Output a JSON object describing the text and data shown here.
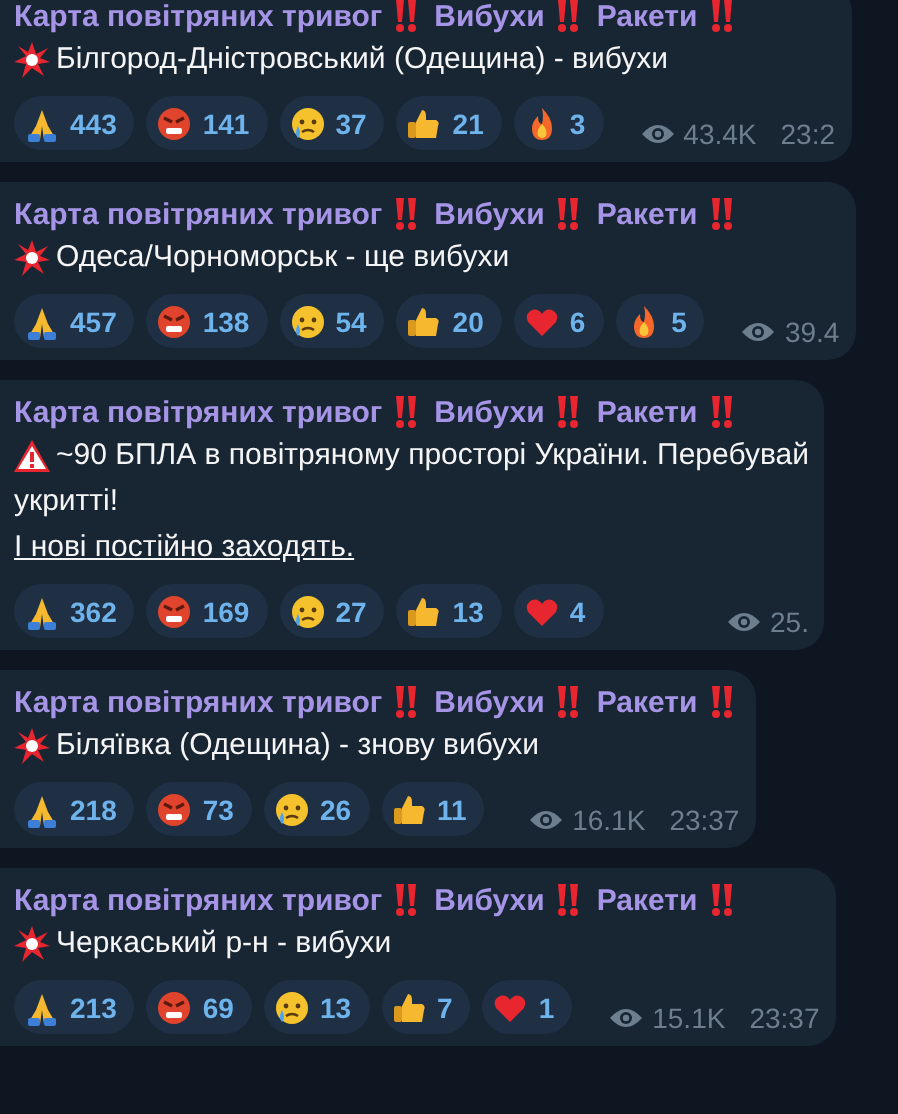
{
  "messages": [
    {
      "title": [
        "Карта повітряних тривог",
        "Вибухи",
        "Ракети"
      ],
      "kind": "explosion",
      "lines": [
        "Білгород-Дністровський (Одещина) - вибухи"
      ],
      "reactions": [
        {
          "kind": "pray",
          "count": "443"
        },
        {
          "kind": "angry",
          "count": "141"
        },
        {
          "kind": "cry",
          "count": "37"
        },
        {
          "kind": "thumbs",
          "count": "21"
        },
        {
          "kind": "fire",
          "count": "3"
        }
      ],
      "views": "43.4K",
      "time": "23:2"
    },
    {
      "title": [
        "Карта повітряних тривог",
        "Вибухи",
        "Ракети"
      ],
      "kind": "explosion",
      "lines": [
        "Одеса/Чорноморськ - ще вибухи"
      ],
      "reactions": [
        {
          "kind": "pray",
          "count": "457"
        },
        {
          "kind": "angry",
          "count": "138"
        },
        {
          "kind": "cry",
          "count": "54"
        },
        {
          "kind": "thumbs",
          "count": "20"
        },
        {
          "kind": "heart",
          "count": "6"
        },
        {
          "kind": "fire",
          "count": "5"
        }
      ],
      "views": "39.4"
    },
    {
      "title": [
        "Карта повітряних тривог",
        "Вибухи",
        "Ракети"
      ],
      "kind": "warning",
      "lines": [
        "~90 БПЛА в повітряному просторі України. Перебувай",
        "укритті!"
      ],
      "link": "І нові постійно заходять.",
      "reactions": [
        {
          "kind": "pray",
          "count": "362"
        },
        {
          "kind": "angry",
          "count": "169"
        },
        {
          "kind": "cry",
          "count": "27"
        },
        {
          "kind": "thumbs",
          "count": "13"
        },
        {
          "kind": "heart",
          "count": "4"
        }
      ],
      "views": "25."
    },
    {
      "title": [
        "Карта повітряних тривог",
        "Вибухи",
        "Ракети"
      ],
      "kind": "explosion",
      "lines": [
        "Біляївка (Одещина) - знову вибухи"
      ],
      "reactions": [
        {
          "kind": "pray",
          "count": "218"
        },
        {
          "kind": "angry",
          "count": "73"
        },
        {
          "kind": "cry",
          "count": "26"
        },
        {
          "kind": "thumbs",
          "count": "11"
        }
      ],
      "views": "16.1K",
      "time": "23:37"
    },
    {
      "title": [
        "Карта повітряних тривог",
        "Вибухи",
        "Ракети"
      ],
      "kind": "explosion",
      "lines": [
        "Черкаський р-н - вибухи"
      ],
      "reactions": [
        {
          "kind": "pray",
          "count": "213"
        },
        {
          "kind": "angry",
          "count": "69"
        },
        {
          "kind": "cry",
          "count": "13"
        },
        {
          "kind": "thumbs",
          "count": "7"
        },
        {
          "kind": "heart",
          "count": "1"
        }
      ],
      "views": "15.1K",
      "time": "23:37"
    }
  ]
}
